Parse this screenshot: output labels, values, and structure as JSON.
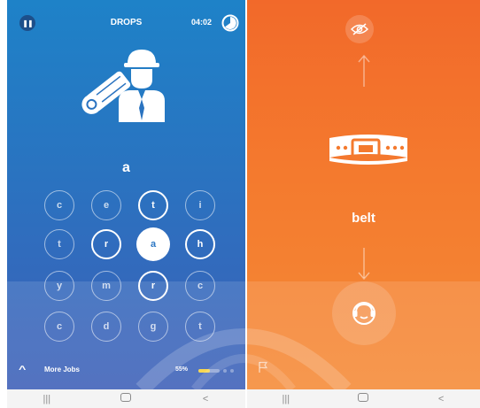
{
  "left_screen": {
    "title": "DROPS",
    "timer": "04:02",
    "answer_letter": "a",
    "letter_grid": [
      [
        "c",
        "e",
        "t",
        "i"
      ],
      [
        "t",
        "r",
        "a",
        "h"
      ],
      [
        "y",
        "m",
        "r",
        "c"
      ],
      [
        "c",
        "d",
        "g",
        "t"
      ]
    ],
    "more_label": "More Jobs",
    "progress_text": "55%",
    "progress_value": 0.55
  },
  "right_screen": {
    "word": "belt"
  },
  "nav": {
    "recents": "|||",
    "back": "<"
  },
  "colors": {
    "left_bg": "#2a73c0",
    "right_bg": "#f47a2e",
    "progress": "#f7d23a"
  },
  "icons": [
    "pause-icon",
    "timer-icon",
    "worker-icon",
    "chevron-up-icon",
    "eye-off-icon",
    "arrow-up-icon",
    "belt-icon",
    "arrow-down-icon",
    "listen-icon",
    "flag-icon"
  ]
}
